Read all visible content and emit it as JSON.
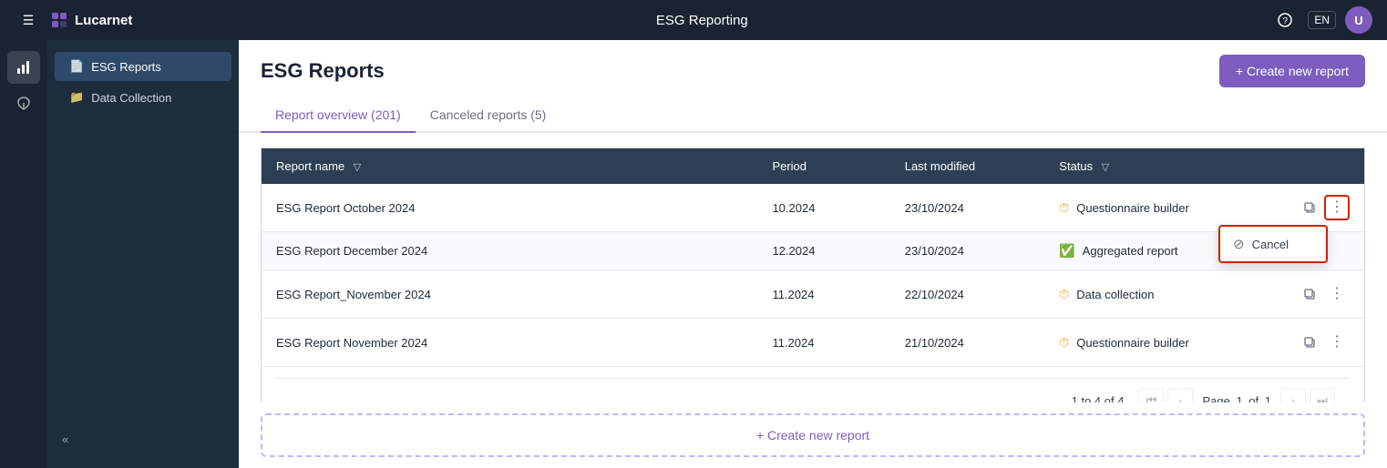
{
  "app": {
    "name": "Lucarnet",
    "page_title": "ESG Reporting",
    "logo_letter": "L"
  },
  "topnav": {
    "hamburger": "☰",
    "help_label": "?",
    "lang_label": "EN",
    "avatar_label": "U"
  },
  "sidebar_icons": [
    {
      "id": "chart-icon",
      "glyph": "📊",
      "active": true
    },
    {
      "id": "leaf-icon",
      "glyph": "🌿",
      "active": false
    }
  ],
  "sidebar": {
    "items": [
      {
        "id": "esg-reports",
        "label": "ESG Reports",
        "icon": "📄",
        "active": true
      },
      {
        "id": "data-collection",
        "label": "Data Collection",
        "icon": "📁",
        "active": false
      }
    ],
    "collapse_label": "«"
  },
  "header": {
    "title": "ESG Reports",
    "create_button_label": "+ Create new report"
  },
  "tabs": [
    {
      "id": "report-overview",
      "label": "Report overview (201)",
      "active": true
    },
    {
      "id": "canceled-reports",
      "label": "Canceled reports (5)",
      "active": false
    }
  ],
  "table": {
    "columns": [
      {
        "id": "report-name",
        "label": "Report name",
        "has_filter": true
      },
      {
        "id": "period",
        "label": "Period",
        "has_filter": false
      },
      {
        "id": "last-modified",
        "label": "Last modified",
        "has_filter": false
      },
      {
        "id": "status",
        "label": "Status",
        "has_filter": true
      },
      {
        "id": "actions",
        "label": "",
        "has_filter": false
      }
    ],
    "rows": [
      {
        "id": "row-1",
        "report_name": "ESG Report October 2024",
        "period": "10.2024",
        "last_modified": "23/10/2024",
        "status_label": "Questionnaire builder",
        "status_type": "orange",
        "show_menu": true,
        "menu_open": false
      },
      {
        "id": "row-2",
        "report_name": "ESG Report December 2024",
        "period": "12.2024",
        "last_modified": "23/10/2024",
        "status_label": "Aggregated report",
        "status_type": "green",
        "show_menu": false,
        "menu_open": true
      },
      {
        "id": "row-3",
        "report_name": "ESG Report_November 2024",
        "period": "11.2024",
        "last_modified": "22/10/2024",
        "status_label": "Data collection",
        "status_type": "orange",
        "show_menu": false,
        "menu_open": false
      },
      {
        "id": "row-4",
        "report_name": "ESG Report November 2024",
        "period": "11.2024",
        "last_modified": "21/10/2024",
        "status_label": "Questionnaire builder",
        "status_type": "orange",
        "show_menu": false,
        "menu_open": false
      }
    ],
    "context_menu": {
      "cancel_label": "Cancel",
      "cancel_icon": "⊘"
    }
  },
  "pagination": {
    "info": "1 to 4 of 4",
    "page_label": "Page",
    "current_page": "1",
    "of_label": "of",
    "total_pages": "1"
  },
  "bottom_create": {
    "label": "+ Create new report"
  }
}
